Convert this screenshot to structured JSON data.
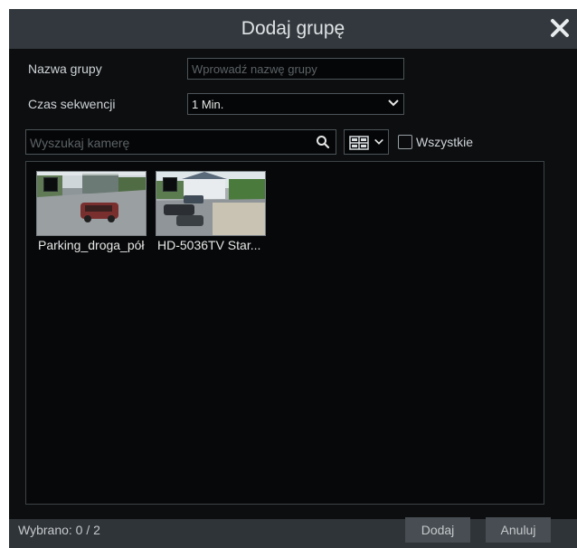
{
  "dialog": {
    "title": "Dodaj grupę",
    "close_icon": "close-icon"
  },
  "form": {
    "group_name_label": "Nazwa grupy",
    "group_name_placeholder": "Wprowadź nazwę grupy",
    "sequence_label": "Czas sekwencji",
    "sequence_value": "1 Min."
  },
  "search": {
    "placeholder": "Wyszukaj kamerę",
    "icon": "search-icon"
  },
  "view": {
    "icon": "grid-view-icon"
  },
  "all": {
    "label": "Wszystkie"
  },
  "cameras": [
    {
      "name": "Parking_droga_pół"
    },
    {
      "name": "HD-5036TV Star..."
    }
  ],
  "footer": {
    "selected": "Wybrano: 0 / 2",
    "add_label": "Dodaj",
    "cancel_label": "Anuluj"
  },
  "colors": {
    "titlebar": "#32383d",
    "background": "#0c0e10",
    "footer": "#2f3438",
    "button": "#474d52"
  }
}
